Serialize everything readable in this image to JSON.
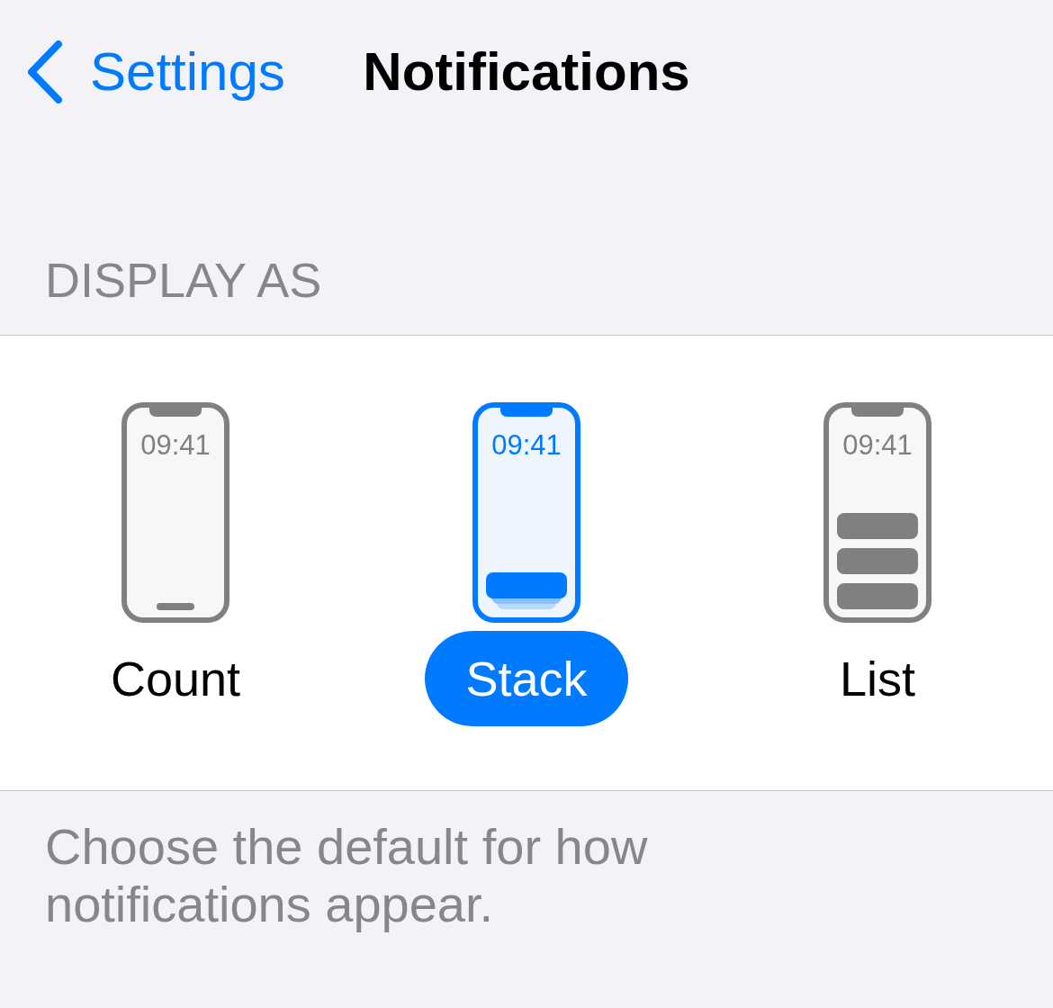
{
  "nav": {
    "back_label": "Settings",
    "title": "Notifications"
  },
  "section": {
    "header": "DISPLAY AS",
    "options": [
      {
        "kind": "count",
        "label": "Count",
        "time": "09:41",
        "selected": false
      },
      {
        "kind": "stack",
        "label": "Stack",
        "time": "09:41",
        "selected": true
      },
      {
        "kind": "list",
        "label": "List",
        "time": "09:41",
        "selected": false
      }
    ],
    "footer": "Choose the default for how notifications appear."
  }
}
